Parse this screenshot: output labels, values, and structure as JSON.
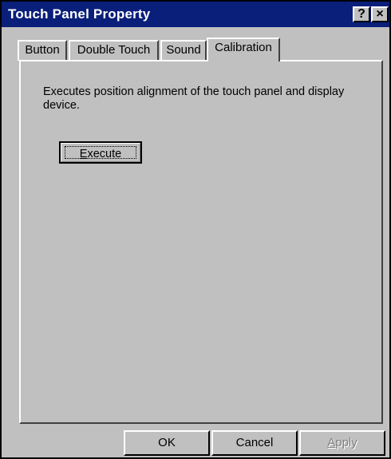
{
  "window": {
    "title": "Touch Panel Property",
    "help_label": "?",
    "close_label": "×"
  },
  "tabs": [
    {
      "label": "Button",
      "active": false
    },
    {
      "label": "Double Touch",
      "active": false
    },
    {
      "label": "Sound",
      "active": false
    },
    {
      "label": "Calibration",
      "active": true
    }
  ],
  "calibration": {
    "description": "Executes position alignment of the touch panel and display device.",
    "execute_mnemonic": "E",
    "execute_rest": "xecute"
  },
  "footer": {
    "ok_label": "OK",
    "cancel_label": "Cancel",
    "apply_mnemonic": "A",
    "apply_rest": "pply",
    "apply_enabled": false
  },
  "colors": {
    "titlebar": "#0a1f7a",
    "face": "#c0c0c0",
    "disabled_text": "#808080"
  }
}
